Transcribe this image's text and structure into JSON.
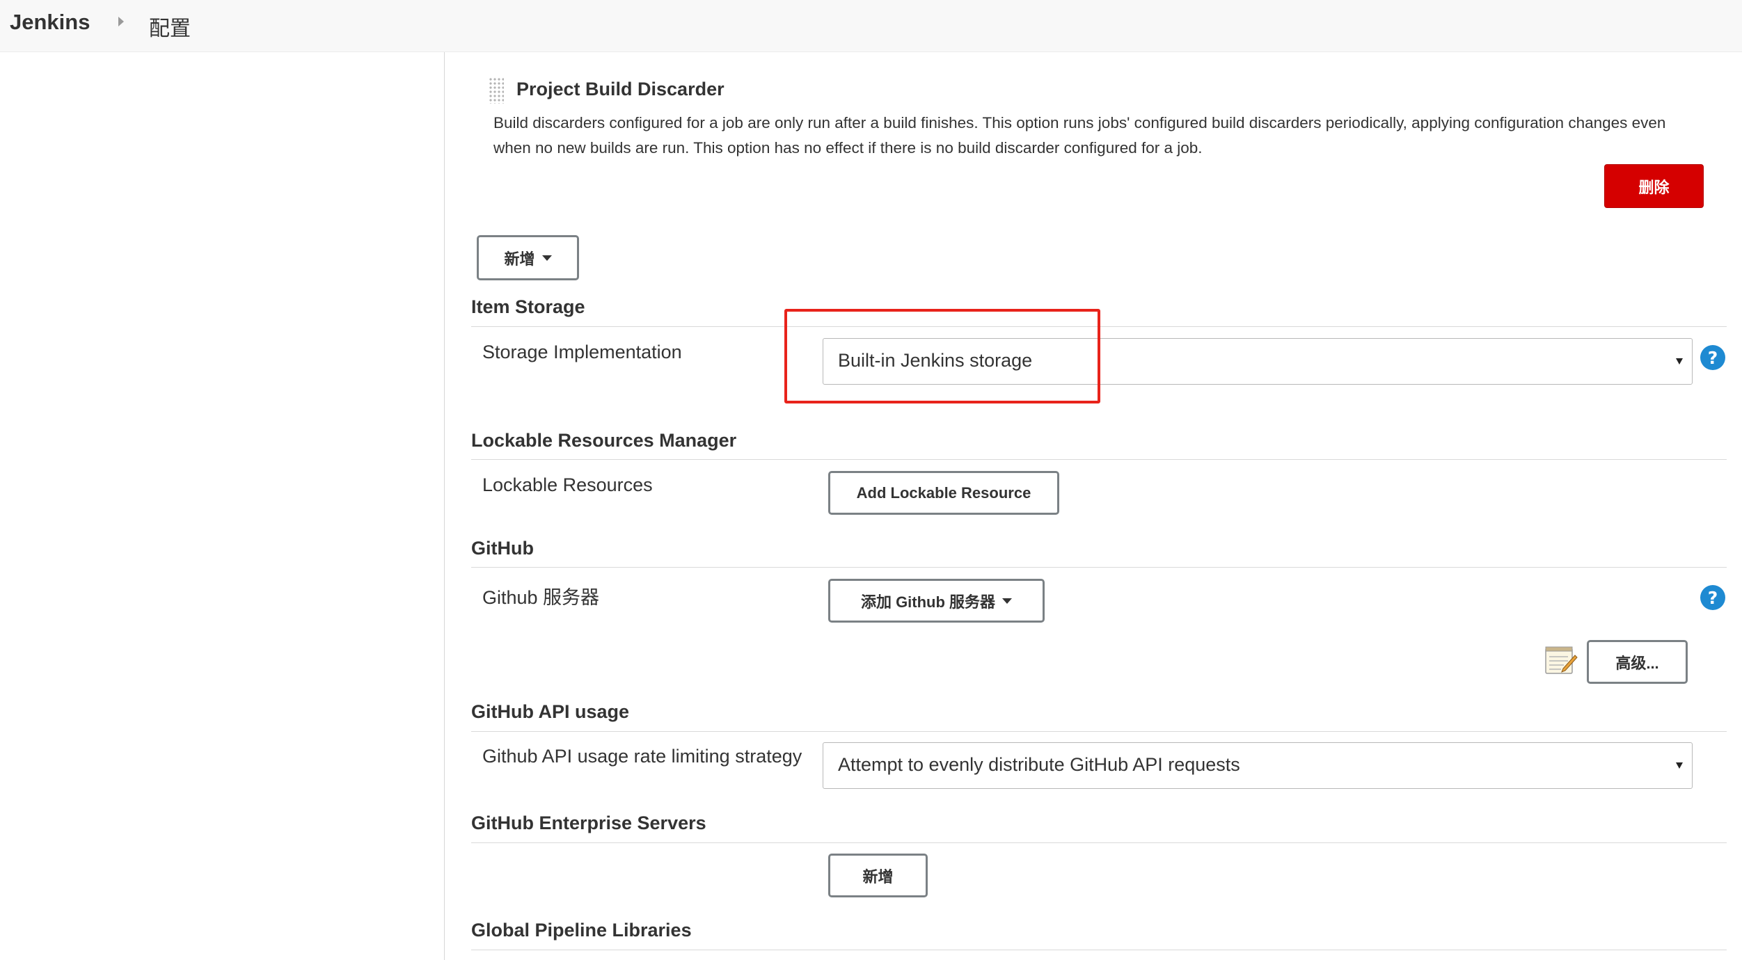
{
  "breadcrumb": {
    "brand": "Jenkins",
    "current": "配置"
  },
  "build_discarder": {
    "title": "Project Build Discarder",
    "description": "Build discarders configured for a job are only run after a build finishes. This option runs jobs' configured build discarders periodically, applying configuration changes even when no new builds are run. This option has no effect if there is no build discarder configured for a job.",
    "delete_label": "删除",
    "add_label": "新增"
  },
  "item_storage": {
    "header": "Item Storage",
    "label": "Storage Implementation",
    "selected": "Built-in Jenkins storage"
  },
  "lockable": {
    "header": "Lockable Resources Manager",
    "label": "Lockable Resources",
    "button": "Add Lockable Resource"
  },
  "github": {
    "header": "GitHub",
    "label": "Github 服务器",
    "add_button": "添加 Github 服务器",
    "advanced_button": "高级..."
  },
  "github_api": {
    "header": "GitHub API usage",
    "label": "Github API usage rate limiting strategy",
    "selected": "Attempt to evenly distribute GitHub API requests"
  },
  "github_enterprise": {
    "header": "GitHub Enterprise Servers",
    "add_button": "新增"
  },
  "pipeline_libs": {
    "header": "Global Pipeline Libraries"
  },
  "icons": {
    "help": "help-icon",
    "notepad": "notepad-icon",
    "drag": "drag-handle-icon",
    "breadcrumb_separator": "chevron-right-icon"
  },
  "colors": {
    "danger": "#d50000",
    "help": "#1e8ad2",
    "highlight": "#e8231b"
  }
}
